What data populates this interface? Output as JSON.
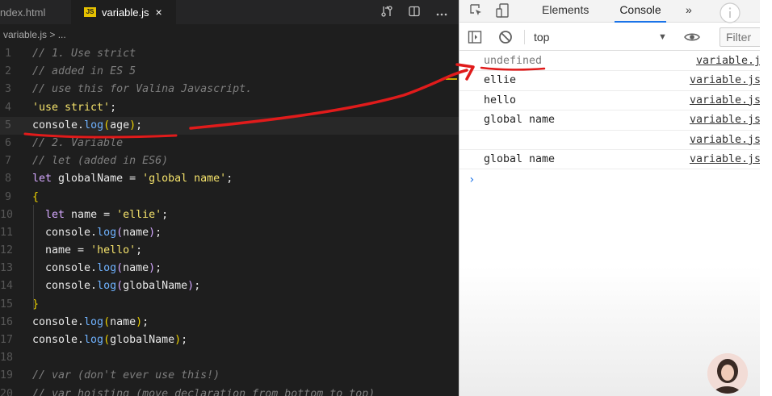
{
  "editor": {
    "tabs": [
      {
        "label": "ndex.html"
      },
      {
        "label": "variable.js",
        "badge": "JS"
      }
    ],
    "tab_close": "×",
    "breadcrumb": "variable.js > ...",
    "tab_actions": [
      "compare-changes-icon",
      "split-editor-icon",
      "more-actions-icon"
    ],
    "lines": [
      {
        "n": "1",
        "parts": [
          {
            "t": "// 1. Use strict",
            "c": "c"
          }
        ]
      },
      {
        "n": "2",
        "parts": [
          {
            "t": "// added in ES 5",
            "c": "c"
          }
        ]
      },
      {
        "n": "3",
        "parts": [
          {
            "t": "// use this for Valina Javascript.",
            "c": "c"
          }
        ]
      },
      {
        "n": "4",
        "parts": [
          {
            "t": "'use strict'",
            "c": "s"
          },
          {
            "t": ";",
            "c": ""
          }
        ]
      },
      {
        "n": "5",
        "parts": [
          {
            "t": "console",
            "c": ""
          },
          {
            "t": ".",
            "c": ""
          },
          {
            "t": "log",
            "c": "m"
          },
          {
            "t": "(",
            "c": "p"
          },
          {
            "t": "age",
            "c": ""
          },
          {
            "t": ")",
            "c": "p"
          },
          {
            "t": ";",
            "c": ""
          }
        ]
      },
      {
        "n": "6",
        "parts": [
          {
            "t": "// 2. Variable",
            "c": "c"
          }
        ]
      },
      {
        "n": "7",
        "parts": [
          {
            "t": "// let (added in ES6)",
            "c": "c"
          }
        ]
      },
      {
        "n": "8",
        "parts": [
          {
            "t": "let",
            "c": "k"
          },
          {
            "t": " globalName = ",
            "c": ""
          },
          {
            "t": "'global name'",
            "c": "s"
          },
          {
            "t": ";",
            "c": ""
          }
        ]
      },
      {
        "n": "9",
        "parts": [
          {
            "t": "{",
            "c": "p"
          }
        ]
      },
      {
        "n": "10",
        "parts": [
          {
            "t": "  ",
            "c": ""
          },
          {
            "t": "let",
            "c": "k"
          },
          {
            "t": " name = ",
            "c": ""
          },
          {
            "t": "'ellie'",
            "c": "s"
          },
          {
            "t": ";",
            "c": ""
          }
        ]
      },
      {
        "n": "11",
        "parts": [
          {
            "t": "  console.",
            "c": ""
          },
          {
            "t": "log",
            "c": "m"
          },
          {
            "t": "(",
            "c": "k"
          },
          {
            "t": "name",
            "c": ""
          },
          {
            "t": ")",
            "c": "k"
          },
          {
            "t": ";",
            "c": ""
          }
        ]
      },
      {
        "n": "12",
        "parts": [
          {
            "t": "  name = ",
            "c": ""
          },
          {
            "t": "'hello'",
            "c": "s"
          },
          {
            "t": ";",
            "c": ""
          }
        ]
      },
      {
        "n": "13",
        "parts": [
          {
            "t": "  console.",
            "c": ""
          },
          {
            "t": "log",
            "c": "m"
          },
          {
            "t": "(",
            "c": "k"
          },
          {
            "t": "name",
            "c": ""
          },
          {
            "t": ")",
            "c": "k"
          },
          {
            "t": ";",
            "c": ""
          }
        ]
      },
      {
        "n": "14",
        "parts": [
          {
            "t": "  console.",
            "c": ""
          },
          {
            "t": "log",
            "c": "m"
          },
          {
            "t": "(",
            "c": "k"
          },
          {
            "t": "globalName",
            "c": ""
          },
          {
            "t": ")",
            "c": "k"
          },
          {
            "t": ";",
            "c": ""
          }
        ]
      },
      {
        "n": "15",
        "parts": [
          {
            "t": "}",
            "c": "p"
          }
        ]
      },
      {
        "n": "16",
        "parts": [
          {
            "t": "console.",
            "c": ""
          },
          {
            "t": "log",
            "c": "m"
          },
          {
            "t": "(",
            "c": "p"
          },
          {
            "t": "name",
            "c": ""
          },
          {
            "t": ")",
            "c": "p"
          },
          {
            "t": ";",
            "c": ""
          }
        ]
      },
      {
        "n": "17",
        "parts": [
          {
            "t": "console.",
            "c": ""
          },
          {
            "t": "log",
            "c": "m"
          },
          {
            "t": "(",
            "c": "p"
          },
          {
            "t": "globalName",
            "c": ""
          },
          {
            "t": ")",
            "c": "p"
          },
          {
            "t": ";",
            "c": ""
          }
        ]
      },
      {
        "n": "18",
        "parts": []
      },
      {
        "n": "19",
        "parts": [
          {
            "t": "// var (don't ever use this!)",
            "c": "c"
          }
        ]
      },
      {
        "n": "20",
        "parts": [
          {
            "t": "// var hoisting (move declaration from bottom to top)",
            "c": "c"
          }
        ]
      }
    ],
    "current_line": "5"
  },
  "devtools": {
    "tabs": [
      "Elements",
      "Console"
    ],
    "more_tabs": "»",
    "context": "top",
    "context_arrow": "▼",
    "filter_placeholder": "Filter",
    "logs": [
      {
        "msg": "undefined",
        "src": "variable.j",
        "undef": true
      },
      {
        "msg": "ellie",
        "src": "variable.js"
      },
      {
        "msg": "hello",
        "src": "variable.js"
      },
      {
        "msg": "global name",
        "src": "variable.js"
      },
      {
        "msg": "",
        "src": "variable.js"
      },
      {
        "msg": "global name",
        "src": "variable.js"
      }
    ],
    "prompt": "›"
  },
  "annotation": {
    "color": "#e01b1b"
  }
}
